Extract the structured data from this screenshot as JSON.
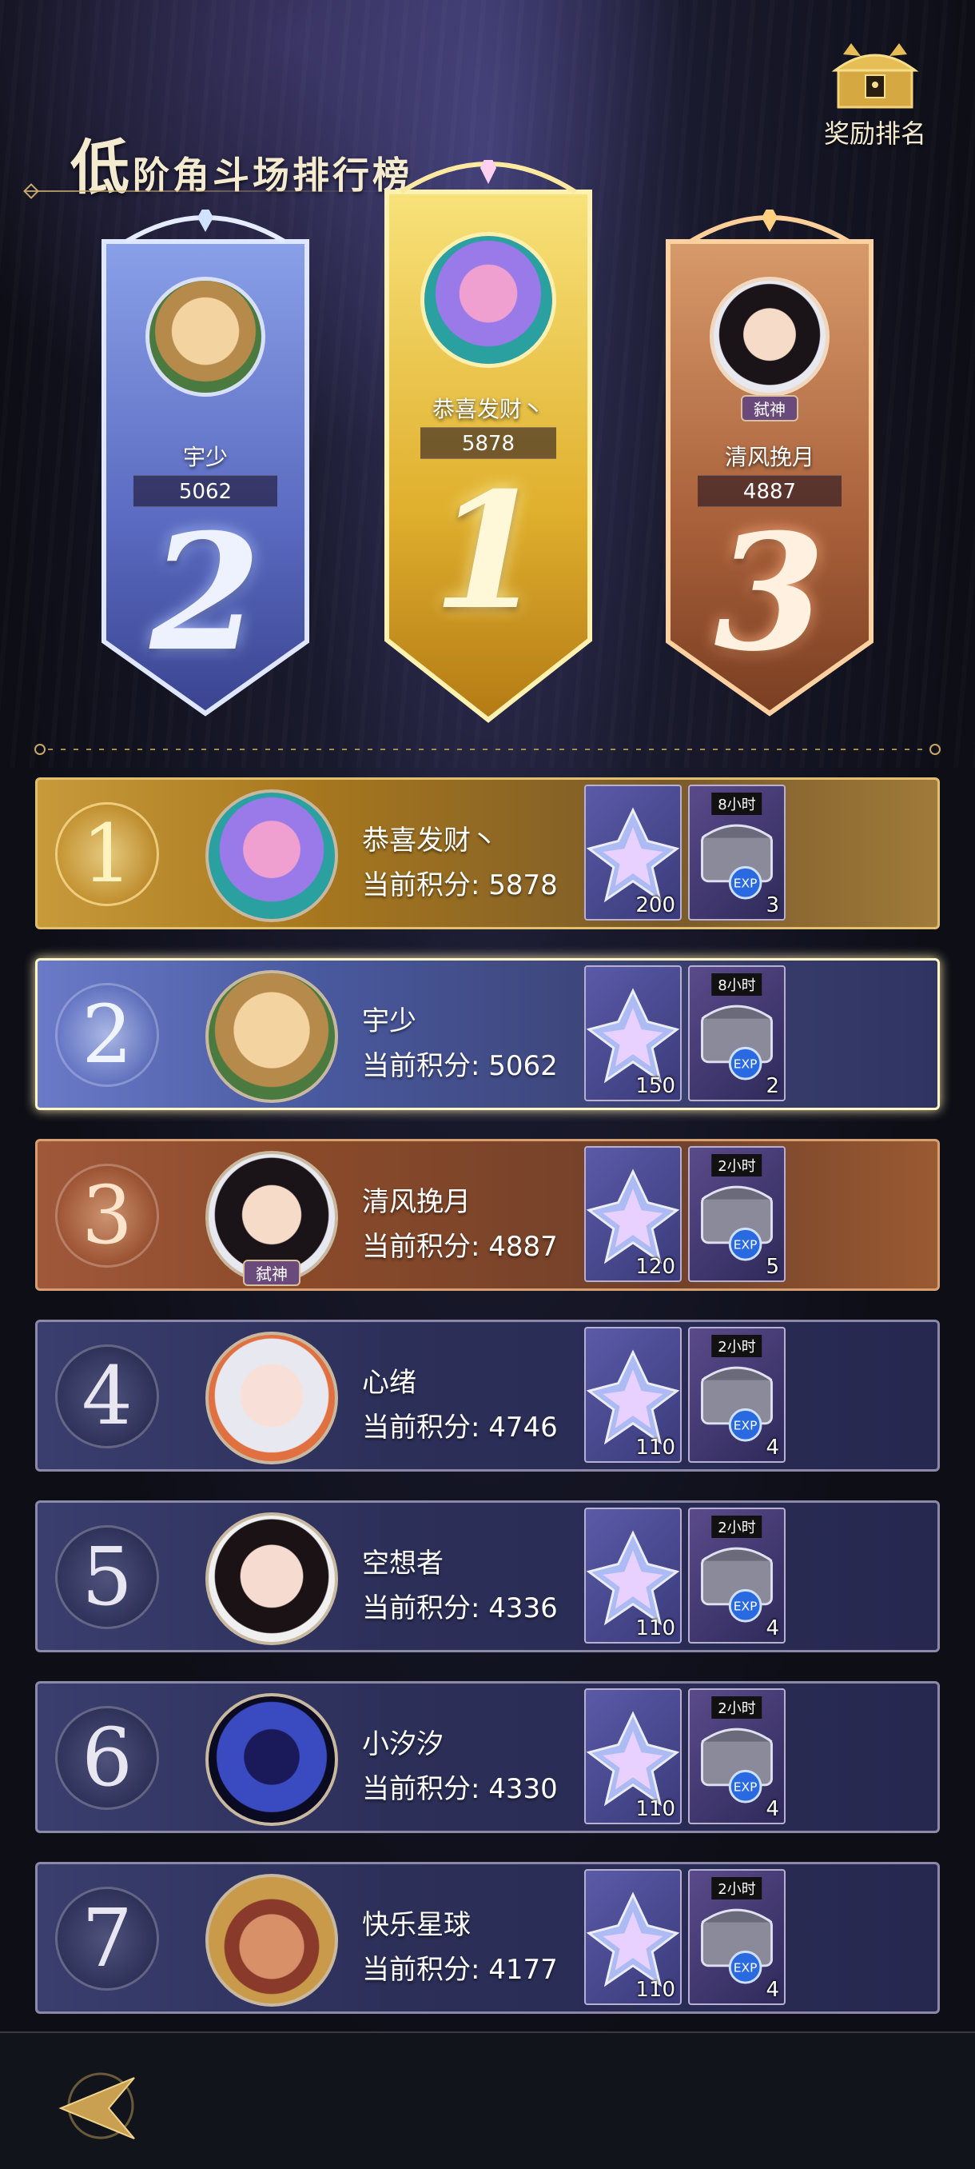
{
  "page": {
    "title_big": "低",
    "title_rest": "阶角斗场排行榜",
    "reward_button_label": "奖励排名"
  },
  "podium": [
    {
      "rank": "2",
      "name": "宇少",
      "score": "5062",
      "avatar": "hamster-avatar"
    },
    {
      "rank": "1",
      "name": "恭喜发财丶",
      "score": "5878",
      "avatar": "purple-hair-avatar"
    },
    {
      "rank": "3",
      "name": "清风挽月",
      "score": "4887",
      "avatar": "girl-angel-avatar",
      "tag": "弑神"
    }
  ],
  "score_label": "当前积分:",
  "rows": [
    {
      "rank": "1",
      "name": "恭喜发财丶",
      "score": "5878",
      "crystal": "200",
      "chest_time": "8小时",
      "chest_count": "3",
      "avatar": "purple-hair-avatar"
    },
    {
      "rank": "2",
      "name": "宇少",
      "score": "5062",
      "crystal": "150",
      "chest_time": "8小时",
      "chest_count": "2",
      "avatar": "hamster-avatar"
    },
    {
      "rank": "3",
      "name": "清风挽月",
      "score": "4887",
      "crystal": "120",
      "chest_time": "2小时",
      "chest_count": "5",
      "avatar": "girl-angel-avatar",
      "tag": "弑神"
    },
    {
      "rank": "4",
      "name": "心绪",
      "score": "4746",
      "crystal": "110",
      "chest_time": "2小时",
      "chest_count": "4",
      "avatar": "white-hair-girl-avatar"
    },
    {
      "rank": "5",
      "name": "空想者",
      "score": "4336",
      "crystal": "110",
      "chest_time": "2小时",
      "chest_count": "4",
      "avatar": "girl-bow-avatar"
    },
    {
      "rank": "6",
      "name": "小汐汐",
      "score": "4330",
      "crystal": "110",
      "chest_time": "2小时",
      "chest_count": "4",
      "avatar": "hooded-figure-avatar"
    },
    {
      "rank": "7",
      "name": "快乐星球",
      "score": "4177",
      "crystal": "110",
      "chest_time": "2小时",
      "chest_count": "4",
      "avatar": "laughing-warrior-avatar"
    }
  ],
  "colors": {
    "gold": "#c89a3a",
    "silver": "#4a5aa0",
    "bronze": "#8a4a2a",
    "normal": "#2c2f58",
    "text": "#f2ead8"
  }
}
